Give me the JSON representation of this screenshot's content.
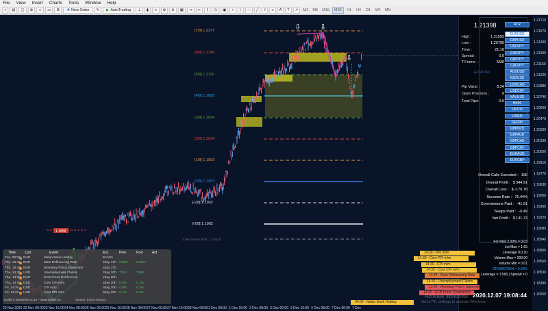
{
  "menu": [
    "File",
    "View",
    "Insert",
    "Charts",
    "Tools",
    "Window",
    "Help"
  ],
  "toolbar": {
    "new_order": "New Order",
    "autotrading": "AutoTrading",
    "timeframes": [
      "M1",
      "M5",
      "M15",
      "M30",
      "H1",
      "H4",
      "D1",
      "W1",
      "MN"
    ],
    "active_timeframe": "M30"
  },
  "fib_labels": [
    "[7/8] 1.2177",
    "[6/8] 1.2146",
    "[5/8] 1.2115",
    "[4/8] 1.2085",
    "[3/8] 1.2054",
    "[2/8] 1.2024",
    "[1/8] 1.1993",
    "[0/8] 1.1963",
    "[-1/8] 1.1932",
    "[-2/8] 1.1902"
  ],
  "price_axis": [
    "1.21710",
    "1.21570",
    "1.21430",
    "1.21300",
    "1.21160",
    "1.21020",
    "1.20880",
    "1.20740",
    "1.20600",
    "1.20470",
    "1.20330",
    "1.20190",
    "1.20050",
    "1.19910",
    "1.19770",
    "1.19630",
    "1.19500",
    "1.19360",
    "1.19220",
    "1.19080",
    "1.18940",
    "1.18800",
    "1.18660",
    "1.18530",
    "1.18390",
    "1.18250"
  ],
  "time_axis": [
    "20 Nov 2020",
    "23 Nov 00:00",
    "23 Nov 16:00",
    "24 Nov 08:00",
    "25 Nov 00:00",
    "25 Nov 16:00",
    "26 Nov 08:00",
    "27 Nov 00:00",
    "27 Nov 16:00",
    "30 Nov 08:00",
    "1 Dec 00:00",
    "1 Dec 16:00",
    "2 Dec 08:00",
    "3 Dec 00:00",
    "3 Dec 16:00",
    "4 Dec 08:00",
    "7 Dec 00:00",
    "7 Dec"
  ],
  "chart_note": "2 Dec Frame Shift : 1.19413",
  "info": {
    "bid": "1.21398",
    "rows": [
      {
        "label": "High :",
        "value": "1.21592"
      },
      {
        "label": "Low :",
        "value": "1.20705"
      },
      {
        "label": "Time :",
        "value": "21:16"
      },
      {
        "label": "Spread :",
        "value": "0.0"
      },
      {
        "label": "T.Frame :",
        "value": "M30"
      }
    ],
    "symbol_label": "EURUSD",
    "pip_rows": [
      {
        "label": "Pip Value :",
        "value": "8.24"
      },
      {
        "label": "Open Positions :",
        "value": "0"
      },
      {
        "label": "Total Pips:",
        "value": "0.0"
      }
    ],
    "atr_button": "ATR",
    "symbols": [
      "EURUSD",
      "GBPUSD",
      "USDJPY",
      "EURJPY",
      "GBPJPY",
      "CADJPY",
      "AUDUSD",
      "NZDUSD",
      "USDCAD",
      "USDCHF",
      "XAUUSD",
      "HK50",
      "UK100",
      "US500",
      "GER30",
      "GBPNZD",
      "GBPAUD",
      "GBPCAD",
      "GBPCHF",
      "EURAUD",
      "EURGBP"
    ],
    "stats": [
      {
        "label": "Overall Calls Executed :",
        "value": "196"
      },
      {
        "label": "Overall Profit :",
        "value": "$ 344.91"
      },
      {
        "label": "Overall Loss :",
        "value": "$ -170.78"
      },
      {
        "label": "Success Rate :",
        "value": "75.44%"
      },
      {
        "label": "Commissions Paid :",
        "value": "-41.91"
      },
      {
        "label": "Swaps Paid :",
        "value": "-0.49"
      },
      {
        "label": "Net Profit :",
        "value": "$ 131.73"
      }
    ],
    "risk": [
      "For Risk 2.00% = 0.03",
      "Lot Max = 1.65",
      "Leverage 0.0.10",
      "Volume Max = 200.00",
      "Volume Min = 0.01",
      "DRAWDOWN = 0.00%",
      "Leverage = 1:500 | Spread = 0"
    ],
    "datetime": "2020.12.07 19:08:44"
  },
  "event_bars": [
    {
      "text": "14:30 - PPI m/m",
      "color": "#f2c23a"
    },
    {
      "text": "14:30 - Core PPI m/m",
      "color": "#f2c23a"
    },
    {
      "text": "14:30 - CPI m/m",
      "color": "#f2c23a"
    },
    {
      "text": "14:30 - Core CPI m/m",
      "color": "#f2c23a"
    },
    {
      "text": "13:45 - Main Refinancing Rate",
      "color": "#e07a3a"
    },
    {
      "text": "14:30 - Unemployment Claims",
      "color": "#f2c23a"
    },
    {
      "text": "13:45 - Monetary Policy Statement",
      "color": "#e0575a"
    },
    {
      "text": "14:30 - ECB Press Conference",
      "color": "#e0575a"
    }
  ],
  "bottom_event": "00:00 - Italian Bank Holiday",
  "events_table": {
    "headers": [
      "Time",
      "Curr.",
      "Event",
      "Ext.",
      "Prev",
      "Fcst",
      "Act"
    ],
    "rows": [
      [
        "Tue, 08:00",
        "EUR",
        "Italian Bank Holiday",
        "Ext 0m",
        "",
        "",
        ""
      ],
      [
        "Thu, 13:45",
        "EUR",
        "Main Refinancing Rate",
        "2day 17h",
        "0.00%",
        "0.00%",
        ""
      ],
      [
        "Thu, 13:45",
        "EUR",
        "Monetary Policy Statement",
        "2day 17h",
        "",
        "",
        ""
      ],
      [
        "Thu, 14:30",
        "USD",
        "Unemployment Claims",
        "2day 20h",
        "712K",
        "725K",
        ""
      ],
      [
        "Thu, 14:30",
        "EUR",
        "ECB Press Conference",
        "2day 20h",
        "",
        "",
        ""
      ],
      [
        "Thu, 14:30",
        "USD",
        "Core CPI m/m",
        "2day 20h",
        "0.0%",
        "0.1%",
        ""
      ],
      [
        "Fri, 14:30",
        "USD",
        "CPI m/m",
        "3day 20h",
        "0.0%",
        "0.1%",
        ""
      ],
      [
        "Fri, 14:30",
        "USD",
        "Core PPI m/m",
        "3day 20h",
        "0.1%",
        "0.2%",
        ""
      ]
    ],
    "footer_left": "DailyFX NewsInfo v2.10 – www.dailyfx.eu",
    "footer_right": "Source: Forex Factory"
  },
  "price_tag": "1.1858",
  "watermark": {
    "line1": "Activate Windows",
    "line2": "Go to PC settings to activate Windows."
  },
  "colors": {
    "accent": "#2c6fc4",
    "bull": "#5fa8ff",
    "bear": "#ff5a6e",
    "zone": "#c7c41f"
  }
}
